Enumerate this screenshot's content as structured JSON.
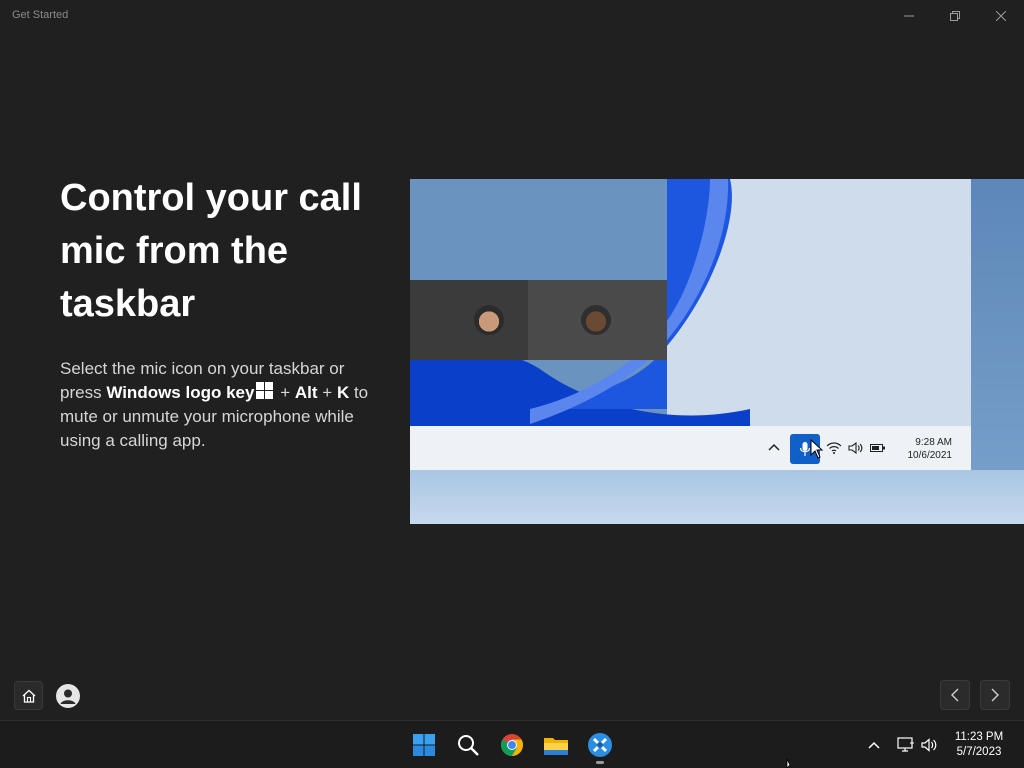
{
  "window": {
    "title": "Get Started",
    "controls": {
      "minimize": "minimize-icon",
      "restore": "restore-icon",
      "close": "close-icon"
    }
  },
  "content": {
    "heading_lines": [
      "Control your call",
      "mic from the",
      "taskbar"
    ],
    "body_pre": "Select the mic icon on your taskbar or press",
    "key_windows": "Windows logo key",
    "plus1": "+",
    "key_alt": "Alt",
    "plus2": "+",
    "key_k": "K",
    "body_post": "to mute or unmute your microphone while using a calling app."
  },
  "illustration": {
    "time": "9:28 AM",
    "date": "10/6/2021"
  },
  "nav": {
    "home_icon": "home-icon",
    "user_icon": "user-avatar-icon",
    "prev_icon": "chevron-left-icon",
    "next_icon": "chevron-right-icon"
  },
  "taskbar": {
    "apps": [
      "start-icon",
      "search-icon",
      "chrome-icon",
      "file-explorer-icon",
      "get-started-icon"
    ],
    "time": "11:23 PM",
    "date": "5/7/2023"
  },
  "colors": {
    "background": "#202020",
    "accent_blue": "#1060c8",
    "taskbar": "#1c1c1c"
  }
}
